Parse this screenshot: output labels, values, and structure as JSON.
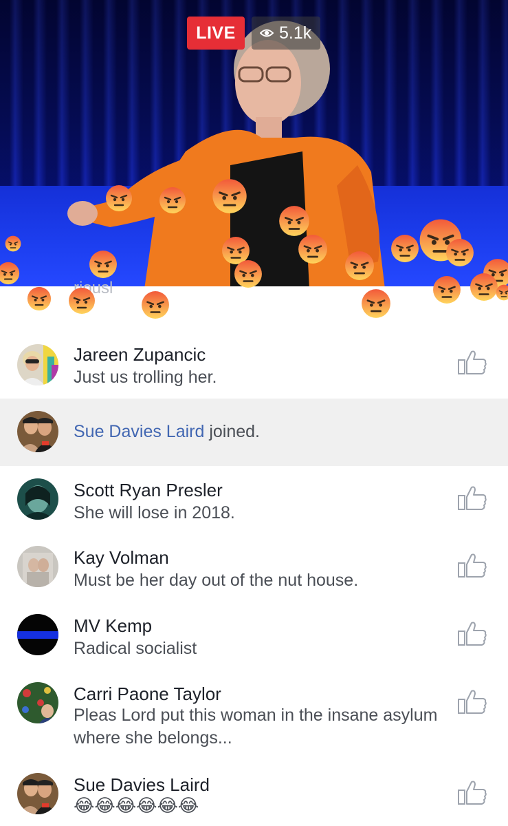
{
  "header": {
    "live_label": "LIVE",
    "viewer_count": "5.1k"
  },
  "faded_comment": {
    "text": "riousl"
  },
  "comments": [
    {
      "name": "Jareen Zupancic",
      "text": "Just us trolling her."
    },
    {
      "name": "Scott Ryan Presler",
      "text": "She will lose in 2018."
    },
    {
      "name": "Kay Volman",
      "text": "Must be her day out of the nut house."
    },
    {
      "name": "MV Kemp",
      "text": "Radical socialist"
    },
    {
      "name": "Carri Paone Taylor",
      "text": "Pleas Lord put this woman in the insane asylum where she belongs..."
    },
    {
      "name": "Sue Davies Laird",
      "text": "😂😂😂😂😂😂"
    }
  ],
  "joined": {
    "who": "Sue Davies Laird",
    "suffix": " joined."
  },
  "colors": {
    "live_red": "#e62e36",
    "link_blue": "#4267b2",
    "angry_top": "#f25a3a",
    "angry_bottom": "#ffd45c"
  },
  "icons": [
    "eye-icon",
    "angry-reaction-icon",
    "like-thumb-icon",
    "laughing-emoji-icon"
  ]
}
